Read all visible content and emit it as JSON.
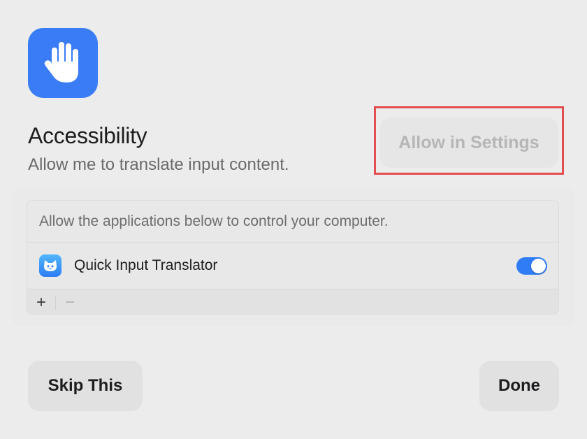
{
  "header": {
    "icon": "raised-hand-icon",
    "title": "Accessibility",
    "subtitle": "Allow me to translate input content.",
    "allow_button_label": "Allow in Settings"
  },
  "permission_panel": {
    "description": "Allow the applications below to control your computer.",
    "apps": [
      {
        "name": "Quick Input Translator",
        "icon": "cat-face-icon",
        "enabled": true
      }
    ],
    "add_label": "+",
    "remove_label": "−"
  },
  "footer": {
    "skip_label": "Skip This",
    "done_label": "Done"
  },
  "colors": {
    "accent": "#3a7cf6",
    "highlight_border": "#e24d4f",
    "toggle_on": "#2f7cf6"
  }
}
